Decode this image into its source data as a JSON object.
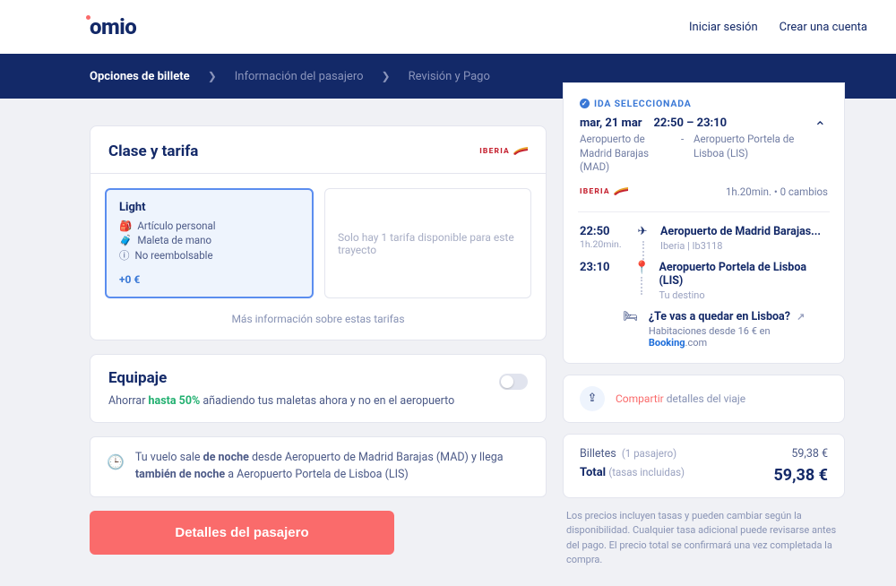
{
  "header": {
    "logo": "omio",
    "login": "Iniciar sesión",
    "signup": "Crear una cuenta"
  },
  "progress": {
    "step1": "Opciones de billete",
    "step2": "Información del pasajero",
    "step3": "Revisión y Pago"
  },
  "fare": {
    "title": "Clase y tarifa",
    "carrier": "IBERIA",
    "selected": {
      "name": "Light",
      "f1": "Artículo personal",
      "f2": "Maleta de mano",
      "f3": "No reembolsable",
      "price": "+0 €"
    },
    "disabled_text": "Solo hay 1 tarifa disponible para este trayecto",
    "more_info": "Más información sobre estas tarifas"
  },
  "baggage": {
    "title": "Equipaje",
    "pre": "Ahorrar ",
    "hl": "hasta 50%",
    "post": " añadiendo tus maletas ahora y no en el aeropuerto"
  },
  "night": {
    "p1": "Tu vuelo sale ",
    "b1": "de noche",
    "p2": " desde Aeropuerto de Madrid Barajas (MAD) y llega ",
    "b2": "también de noche",
    "p3": " a Aeropuerto Portela de Lisboa (LIS)"
  },
  "continue": "Detalles del pasajero",
  "summary": {
    "badge": "IDA SELECCIONADA",
    "date": "mar, 21 mar",
    "time_range": "22:50 – 23:10",
    "from_ap": "Aeropuerto de Madrid Barajas (MAD)",
    "to_ap": "Aeropuerto Portela de Lisboa (LIS)",
    "carrier": "IBERIA",
    "meta": "1h.20min. • 0 cambios",
    "leg1": {
      "time": "22:50",
      "dur": "1h.20min.",
      "title": "Aeropuerto de Madrid Barajas...",
      "sub": "Iberia | Ib3118"
    },
    "leg2": {
      "time": "23:10",
      "title": "Aeropuerto Portela de Lisboa (LIS)",
      "sub": "Tu destino"
    },
    "stay": {
      "q": "¿Te vas a quedar en Lisboa?",
      "sub_pre": "Habitaciones desde 16 € en ",
      "booking": "Booking",
      "com": ".com"
    }
  },
  "share": {
    "hl": "Compartir",
    "rest": " detalles del viaje"
  },
  "price": {
    "label": "Billetes",
    "sub": "(1 pasajero)",
    "amount": "59,38 €",
    "total_label": "Total",
    "total_sub": "(tasas incluidas)",
    "total_amount": "59,38 €"
  },
  "disclaimer": "Los precios incluyen tasas y pueden cambiar según la disponibilidad. Cualquier tasa adicional puede revisarse antes del pago. El precio total se confirmará una vez completada la compra."
}
